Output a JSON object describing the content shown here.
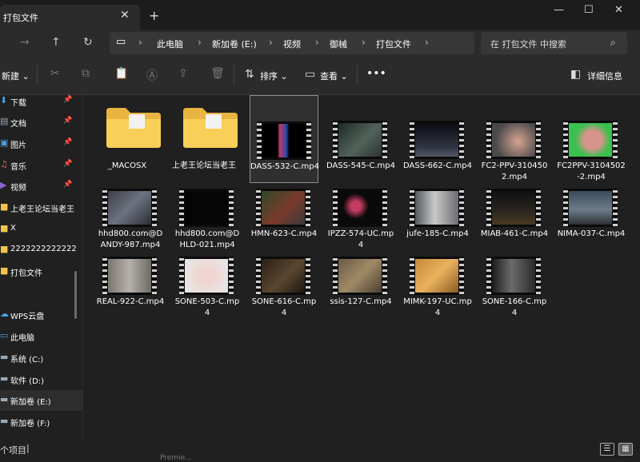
{
  "tab": {
    "title": "打包文件"
  },
  "address": {
    "crumbs": [
      "此电脑",
      "新加卷 (E:)",
      "视频",
      "御械",
      "打包文件"
    ]
  },
  "search": {
    "placeholder": "在 打包文件 中搜索"
  },
  "toolbar": {
    "new_label": "新建",
    "sort_label": "排序",
    "view_label": "查看",
    "details_label": "详细信息"
  },
  "sidebar": {
    "items": [
      {
        "label": "下载",
        "icon": "download-icon"
      },
      {
        "label": "文档",
        "icon": "document-icon"
      },
      {
        "label": "图片",
        "icon": "picture-icon"
      },
      {
        "label": "音乐",
        "icon": "music-icon"
      },
      {
        "label": "视频",
        "icon": "video-icon"
      },
      {
        "label": "上老王论坛当老王",
        "icon": "folder-icon"
      },
      {
        "label": "X",
        "icon": "folder-icon"
      },
      {
        "label": "2222222222222",
        "icon": "folder-icon"
      },
      {
        "label": "打包文件",
        "icon": "folder-icon"
      },
      {
        "label": "WPS云盘",
        "icon": "cloud-icon"
      },
      {
        "label": "此电脑",
        "icon": "computer-icon"
      },
      {
        "label": "系统 (C:)",
        "icon": "drive-icon"
      },
      {
        "label": "软件 (D:)",
        "icon": "drive-icon"
      },
      {
        "label": "新加卷 (E:)",
        "icon": "drive-icon"
      },
      {
        "label": "新加卷 (F:)",
        "icon": "drive-icon"
      }
    ]
  },
  "files": [
    {
      "name": "_MACOSX",
      "type": "folder"
    },
    {
      "name": "上老王论坛当老王",
      "type": "folder"
    },
    {
      "name": "DASS-532-C.mp4",
      "type": "video"
    },
    {
      "name": "DASS-545-C.mp4",
      "type": "video"
    },
    {
      "name": "DASS-662-C.mp4",
      "type": "video"
    },
    {
      "name": "FC2-PPV-3104502.mp4",
      "type": "video"
    },
    {
      "name": "FC2PPV-3104502-2.mp4",
      "type": "video"
    },
    {
      "name": "hhd800.com@DANDY-987.mp4",
      "type": "video"
    },
    {
      "name": "hhd800.com@DHLD-021.mp4",
      "type": "video"
    },
    {
      "name": "HMN-623-C.mp4",
      "type": "video"
    },
    {
      "name": "IPZZ-574-UC.mp4",
      "type": "video"
    },
    {
      "name": "jufe-185-C.mp4",
      "type": "video"
    },
    {
      "name": "MIAB-461-C.mp4",
      "type": "video"
    },
    {
      "name": "NIMA-037-C.mp4",
      "type": "video"
    },
    {
      "name": "REAL-922-C.mp4",
      "type": "video"
    },
    {
      "name": "SONE-503-C.mp4",
      "type": "video"
    },
    {
      "name": "SONE-616-C.mp4",
      "type": "video"
    },
    {
      "name": "ssis-127-C.mp4",
      "type": "video"
    },
    {
      "name": "MIMK-197-UC.mp4",
      "type": "video"
    },
    {
      "name": "SONE-166-C.mp4",
      "type": "video"
    }
  ],
  "status": {
    "text": "个项目"
  },
  "ghost_text": "Premie..."
}
